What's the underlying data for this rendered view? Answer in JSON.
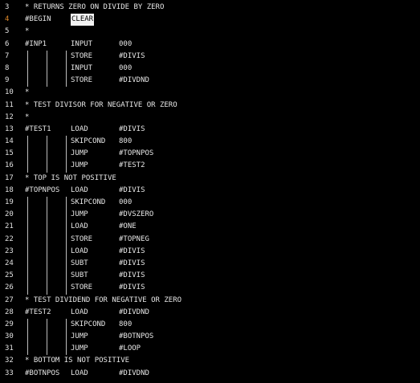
{
  "editor": {
    "lines": [
      {
        "n": "3",
        "kind": "comment",
        "text": "* RETURNS ZERO ON DIVIDE BY ZERO"
      },
      {
        "n": "4",
        "kind": "label-op",
        "label": "#BEGIN",
        "op": "CLEAR",
        "arg": "",
        "current": true,
        "selected": true
      },
      {
        "n": "5",
        "kind": "comment",
        "text": "*"
      },
      {
        "n": "6",
        "kind": "label-op",
        "label": "#INP1",
        "op": "INPUT",
        "arg": "000"
      },
      {
        "n": "7",
        "kind": "op",
        "op": "STORE",
        "arg": "#DIVIS"
      },
      {
        "n": "8",
        "kind": "op",
        "op": "INPUT",
        "arg": "000"
      },
      {
        "n": "9",
        "kind": "op",
        "op": "STORE",
        "arg": "#DIVDND"
      },
      {
        "n": "10",
        "kind": "comment",
        "text": "*"
      },
      {
        "n": "11",
        "kind": "comment",
        "text": "* TEST DIVISOR FOR NEGATIVE OR ZERO"
      },
      {
        "n": "12",
        "kind": "comment",
        "text": "*"
      },
      {
        "n": "13",
        "kind": "label-op",
        "label": "#TEST1",
        "op": "LOAD",
        "arg": "#DIVIS"
      },
      {
        "n": "14",
        "kind": "op",
        "op": "SKIPCOND",
        "arg": "800"
      },
      {
        "n": "15",
        "kind": "op",
        "op": "JUMP",
        "arg": "#TOPNPOS"
      },
      {
        "n": "16",
        "kind": "op",
        "op": "JUMP",
        "arg": "#TEST2"
      },
      {
        "n": "17",
        "kind": "comment",
        "text": "* TOP IS NOT POSITIVE"
      },
      {
        "n": "18",
        "kind": "label-op",
        "label": "#TOPNPOS",
        "op": "LOAD",
        "arg": "#DIVIS"
      },
      {
        "n": "19",
        "kind": "op",
        "op": "SKIPCOND",
        "arg": "000"
      },
      {
        "n": "20",
        "kind": "op",
        "op": "JUMP",
        "arg": "#DVSZERO"
      },
      {
        "n": "21",
        "kind": "op",
        "op": "LOAD",
        "arg": "#ONE"
      },
      {
        "n": "22",
        "kind": "op",
        "op": "STORE",
        "arg": "#TOPNEG"
      },
      {
        "n": "23",
        "kind": "op",
        "op": "LOAD",
        "arg": "#DIVIS"
      },
      {
        "n": "24",
        "kind": "op",
        "op": "SUBT",
        "arg": "#DIVIS"
      },
      {
        "n": "25",
        "kind": "op",
        "op": "SUBT",
        "arg": "#DIVIS"
      },
      {
        "n": "26",
        "kind": "op",
        "op": "STORE",
        "arg": "#DIVIS"
      },
      {
        "n": "27",
        "kind": "comment",
        "text": "* TEST DIVIDEND FOR NEGATIVE OR ZERO"
      },
      {
        "n": "28",
        "kind": "label-op",
        "label": "#TEST2",
        "op": "LOAD",
        "arg": "#DIVDND"
      },
      {
        "n": "29",
        "kind": "op",
        "op": "SKIPCOND",
        "arg": "800"
      },
      {
        "n": "30",
        "kind": "op",
        "op": "JUMP",
        "arg": "#BOTNPOS"
      },
      {
        "n": "31",
        "kind": "op",
        "op": "JUMP",
        "arg": "#LOOP"
      },
      {
        "n": "32",
        "kind": "comment",
        "text": "* BOTTOM IS NOT POSITIVE"
      },
      {
        "n": "33",
        "kind": "label-op",
        "label": "#BOTNPOS",
        "op": "LOAD",
        "arg": "#DIVDND"
      }
    ],
    "colors": {
      "background": "#000000",
      "text": "#e6e6e6",
      "current_line_number": "#e08a2a",
      "selection_bg": "#f2f2f2"
    }
  }
}
